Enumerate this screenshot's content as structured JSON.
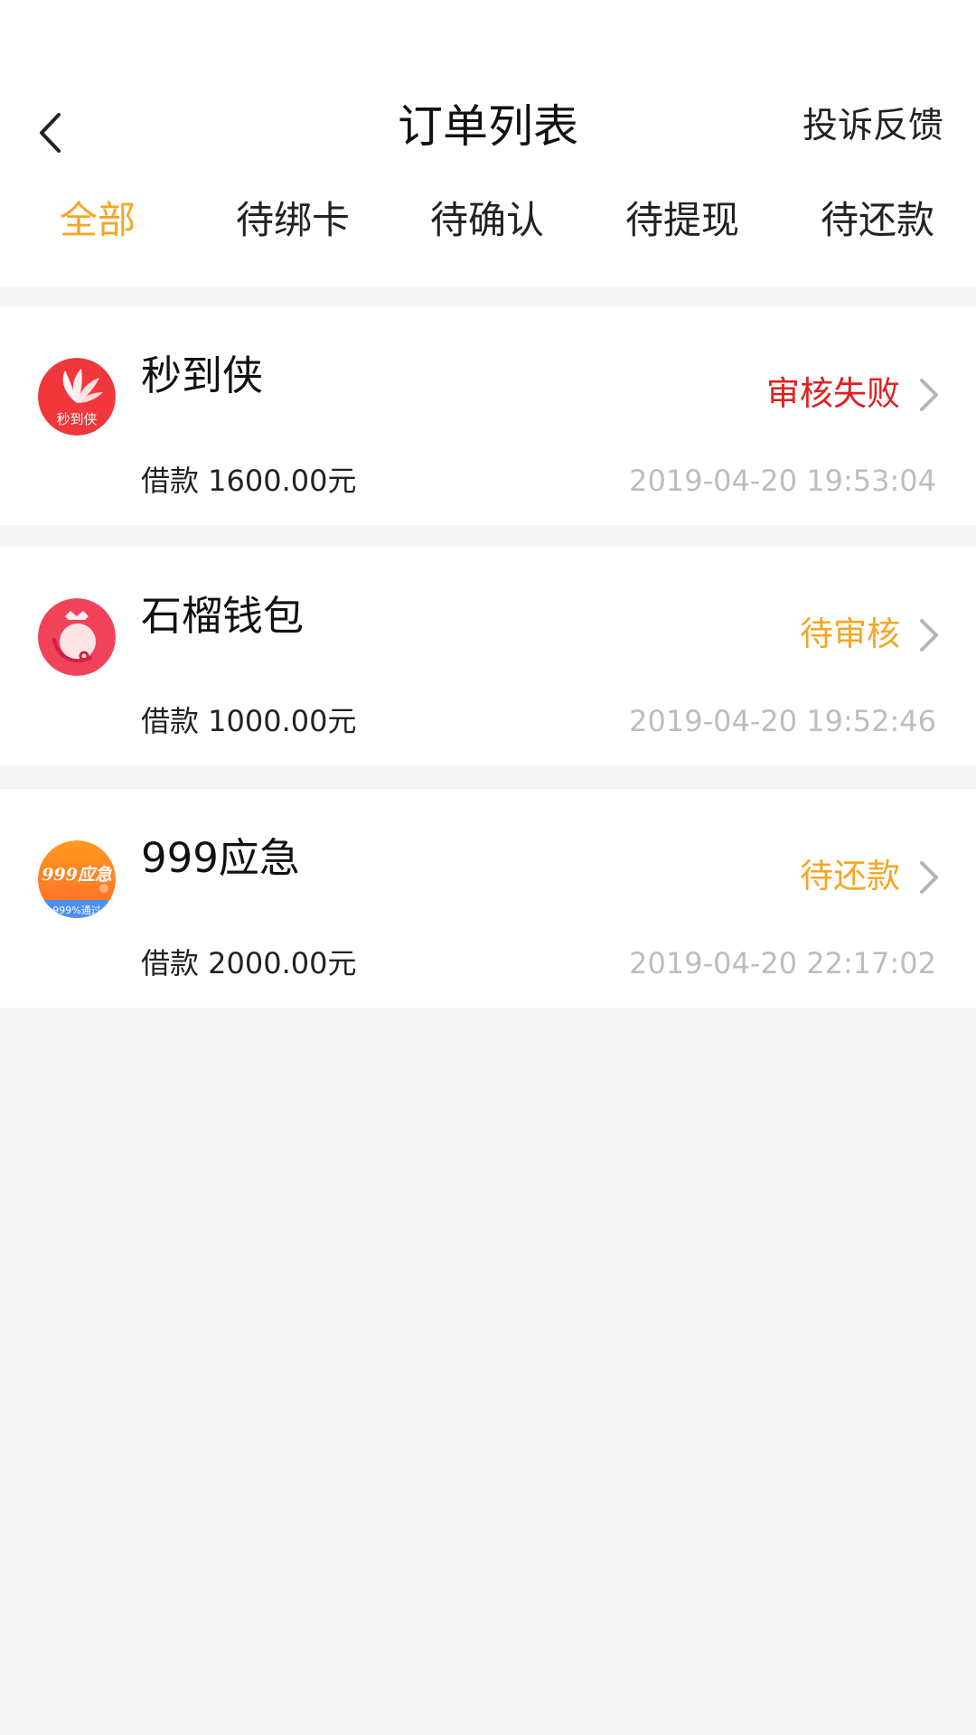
{
  "header": {
    "title": "订单列表",
    "feedback_label": "投诉反馈"
  },
  "tabs": [
    {
      "label": "全部",
      "active": true
    },
    {
      "label": "待绑卡",
      "active": false
    },
    {
      "label": "待确认",
      "active": false
    },
    {
      "label": "待提现",
      "active": false
    },
    {
      "label": "待还款",
      "active": false
    }
  ],
  "orders": [
    {
      "name": "秒到侠",
      "logo_text": "秒到侠",
      "status": "审核失败",
      "status_color": "#e02020",
      "amount": "借款 1600.00元",
      "time": "2019-04-20 19:53:04"
    },
    {
      "name": "石榴钱包",
      "status": "待审核",
      "status_color": "#f5a623",
      "amount": "借款 1000.00元",
      "time": "2019-04-20 19:52:46"
    },
    {
      "name": "999应急",
      "logo_text": "999应急",
      "logo_subtext": "999%通过",
      "status": "待还款",
      "status_color": "#f5a623",
      "amount": "借款 2000.00元",
      "time": "2019-04-20 22:17:02"
    }
  ],
  "colors": {
    "accent": "#f5a623",
    "fail": "#e02020",
    "muted": "#bdbdbd",
    "background": "#f4f4f4"
  },
  "icons": {
    "back": "chevron-left-icon",
    "row_arrow": "chevron-right-icon"
  }
}
